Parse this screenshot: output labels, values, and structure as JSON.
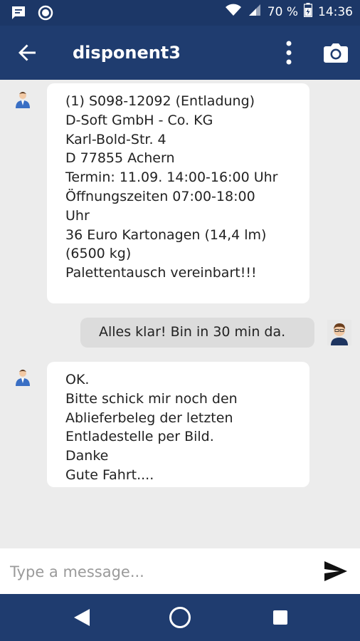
{
  "status_bar": {
    "battery_text": "70 %",
    "time": "14:36",
    "left_icons": [
      "message-icon",
      "circle-icon"
    ],
    "right_icons": [
      "wifi-icon",
      "signal-icon",
      "battery-icon"
    ]
  },
  "header": {
    "title": "disponent3",
    "icons": [
      "back-arrow-icon",
      "more-vertical-icon",
      "camera-icon"
    ]
  },
  "messages": [
    {
      "direction": "incoming",
      "avatar": "dispatcher-avatar-icon",
      "text": "(1) S098-12092 (Entladung)\nD-Soft GmbH - Co. KG\nKarl-Bold-Str. 4\nD 77855 Achern\nTermin: 11.09. 14:00-16:00 Uhr\nÖffnungszeiten 07:00-18:00\nUhr\n36 Euro Kartonagen (14,4 lm)\n(6500 kg)\nPalettentausch vereinbart!!!"
    },
    {
      "direction": "outgoing",
      "avatar": "user-avatar-icon",
      "text": "Alles klar! Bin in 30 min da."
    },
    {
      "direction": "incoming",
      "avatar": "dispatcher-avatar-icon",
      "text": "OK.\nBitte schick mir noch den\nAblieferbeleg der letzten\nEntladestelle per Bild.\nDanke\nGute Fahrt...."
    }
  ],
  "composer": {
    "placeholder": "Type a message...",
    "value": "",
    "send_icon": "send-icon"
  },
  "nav_bar": {
    "icons": [
      "nav-back-icon",
      "nav-home-icon",
      "nav-recents-icon"
    ]
  },
  "colors": {
    "app_bar": "#1f3c6f",
    "status_bar": "#1c3767",
    "chat_background": "#ececec",
    "incoming_bubble": "#ffffff",
    "outgoing_bubble": "#dcdcdc"
  }
}
